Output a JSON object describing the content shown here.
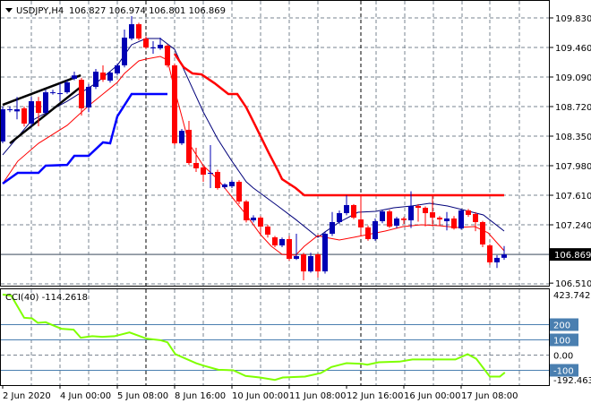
{
  "header": {
    "symbol_timeframe": "USDJPY,H4",
    "ohlc": "106.827 106.974 106.801 106.869"
  },
  "indicator": {
    "label": "CCI(40) -114.2618",
    "max_label": "423.7426",
    "min_label": "-192.4639",
    "levels": [
      {
        "value": 200,
        "label": "200"
      },
      {
        "value": 100,
        "label": "100"
      },
      {
        "value": 0,
        "label": "0.00"
      },
      {
        "value": -100,
        "label": "-100"
      }
    ]
  },
  "colors": {
    "bull": "#0000b4",
    "bear": "#ff0000",
    "grid": "#7a8490",
    "ma_fast": "#00007a",
    "ma_slow": "#ff0000",
    "envelope_red": "#ff0000",
    "envelope_blue": "#0000ff",
    "cci": "#7fff00",
    "level_line": "#4a7fb0",
    "price_tag_bg": "#000000"
  },
  "chart_data": {
    "type": "candlestick",
    "title": "USDJPY,H4",
    "ylim": [
      106.51,
      109.83
    ],
    "price_ticks": [
      "109.830",
      "109.460",
      "109.090",
      "108.720",
      "108.350",
      "107.980",
      "107.610",
      "107.240",
      "106.510"
    ],
    "current_price": "106.869",
    "x_tick_labels": [
      "2 Jun 2020",
      "4 Jun 00:00",
      "5 Jun 08:00",
      "8 Jun 16:00",
      "10 Jun 00:00",
      "11 Jun 08:00",
      "12 Jun 16:00",
      "16 Jun 00:00",
      "17 Jun 08:00"
    ],
    "candles": [
      [
        108.283,
        108.686,
        108.72,
        108.26
      ],
      [
        108.686,
        108.686,
        108.72,
        108.65
      ],
      [
        108.66,
        108.686,
        108.84,
        108.56
      ],
      [
        108.698,
        108.507,
        108.72,
        108.47
      ],
      [
        108.507,
        108.787,
        108.84,
        108.47
      ],
      [
        108.787,
        108.641,
        108.84,
        108.473
      ],
      [
        108.641,
        108.899,
        108.93,
        108.62
      ],
      [
        108.899,
        108.899,
        108.93,
        108.87
      ],
      [
        108.88,
        108.888,
        109.011,
        108.787
      ],
      [
        108.899,
        109.023,
        109.05,
        108.88
      ],
      [
        109.068,
        109.11,
        109.157,
        109.05
      ],
      [
        109.056,
        108.698,
        109.08,
        108.608
      ],
      [
        108.709,
        108.967,
        109.0,
        108.65
      ],
      [
        108.967,
        109.157,
        109.191,
        108.94
      ],
      [
        109.146,
        109.056,
        109.236,
        109.03
      ],
      [
        109.045,
        109.146,
        109.16,
        109.02
      ],
      [
        109.135,
        109.236,
        109.26,
        109.11
      ],
      [
        109.236,
        109.583,
        109.684,
        109.21
      ],
      [
        109.572,
        109.751,
        109.852,
        109.55
      ],
      [
        109.751,
        109.572,
        109.77,
        109.55
      ],
      [
        109.572,
        109.46,
        109.6,
        109.44
      ],
      [
        109.46,
        109.46,
        109.538,
        109.381
      ],
      [
        109.449,
        109.494,
        109.583,
        109.43
      ],
      [
        109.482,
        109.236,
        109.5,
        109.21
      ],
      [
        109.236,
        108.26,
        109.26,
        108.24
      ],
      [
        108.26,
        108.417,
        108.44,
        108.24
      ],
      [
        108.429,
        108.014,
        108.541,
        107.99
      ],
      [
        108.014,
        107.947,
        108.204,
        107.902
      ],
      [
        107.958,
        107.868,
        107.98,
        107.778
      ],
      [
        107.891,
        107.891,
        108.238,
        107.7
      ],
      [
        107.902,
        107.7,
        107.93,
        107.68
      ],
      [
        107.711,
        107.745,
        107.76,
        107.69
      ],
      [
        107.722,
        107.778,
        107.8,
        107.7
      ],
      [
        107.778,
        107.532,
        107.8,
        107.5
      ],
      [
        107.532,
        107.296,
        107.55,
        107.27
      ],
      [
        107.296,
        107.33,
        107.36,
        107.27
      ],
      [
        107.33,
        107.218,
        107.35,
        107.12
      ],
      [
        107.218,
        107.117,
        107.24,
        107.08
      ],
      [
        107.083,
        106.982,
        107.1,
        106.96
      ],
      [
        106.982,
        107.061,
        107.08,
        106.96
      ],
      [
        107.061,
        106.814,
        107.1,
        106.79
      ],
      [
        106.814,
        106.848,
        107.128,
        106.8
      ],
      [
        106.87,
        106.657,
        106.89,
        106.545
      ],
      [
        106.657,
        106.848,
        106.89,
        106.64
      ],
      [
        106.87,
        106.657,
        106.88,
        106.58
      ],
      [
        106.657,
        107.128,
        107.15,
        106.63
      ],
      [
        107.128,
        107.274,
        107.4,
        107.1
      ],
      [
        107.274,
        107.386,
        107.42,
        107.25
      ],
      [
        107.386,
        107.487,
        107.61,
        107.36
      ],
      [
        107.487,
        107.33,
        107.5,
        107.31
      ],
      [
        107.307,
        107.207,
        107.61,
        107.1
      ],
      [
        107.207,
        107.061,
        107.23,
        107.04
      ],
      [
        107.061,
        107.285,
        107.32,
        107.04
      ],
      [
        107.285,
        107.408,
        107.43,
        107.26
      ],
      [
        107.408,
        107.218,
        107.43,
        107.2
      ],
      [
        107.229,
        107.319,
        107.34,
        107.2
      ],
      [
        107.319,
        107.3,
        107.34,
        107.25
      ],
      [
        107.296,
        107.476,
        107.66,
        107.2
      ],
      [
        107.476,
        107.453,
        107.5,
        107.28
      ],
      [
        107.453,
        107.386,
        107.47,
        107.22
      ],
      [
        107.397,
        107.33,
        107.61,
        107.22
      ],
      [
        107.33,
        107.307,
        107.35,
        107.23
      ],
      [
        107.285,
        107.319,
        107.4,
        107.17
      ],
      [
        107.319,
        107.195,
        107.35,
        107.18
      ],
      [
        107.195,
        107.42,
        107.44,
        107.18
      ],
      [
        107.42,
        107.364,
        107.44,
        107.34
      ],
      [
        107.375,
        107.274,
        107.4,
        107.16
      ],
      [
        107.274,
        106.994,
        107.29,
        106.96
      ],
      [
        106.982,
        106.77,
        107.0,
        106.74
      ],
      [
        106.77,
        106.826,
        106.86,
        106.7
      ],
      [
        106.827,
        106.869,
        106.974,
        106.801
      ]
    ],
    "lines": [
      {
        "name": "ma-fast",
        "points": [
          [
            0,
            108.115
          ],
          [
            4,
            108.541
          ],
          [
            9,
            108.787
          ],
          [
            13,
            109.011
          ],
          [
            16,
            109.236
          ],
          [
            18,
            109.494
          ],
          [
            20,
            109.572
          ],
          [
            22,
            109.572
          ],
          [
            24,
            109.437
          ],
          [
            26,
            109.045
          ],
          [
            28,
            108.653
          ],
          [
            30,
            108.317
          ],
          [
            32,
            108.036
          ],
          [
            34,
            107.778
          ],
          [
            35,
            107.7
          ],
          [
            38.4,
            107.476
          ],
          [
            40.9,
            107.307
          ],
          [
            44,
            107.083
          ],
          [
            45,
            107.151
          ],
          [
            47,
            107.274
          ],
          [
            49.6,
            107.397
          ],
          [
            52.1,
            107.408
          ],
          [
            54.6,
            107.453
          ],
          [
            57.1,
            107.476
          ],
          [
            59.6,
            107.509
          ],
          [
            62.1,
            107.476
          ],
          [
            64.6,
            107.42
          ],
          [
            67.1,
            107.364
          ],
          [
            70,
            107.162
          ]
        ]
      },
      {
        "name": "ma-slow",
        "points": [
          [
            0,
            107.756
          ],
          [
            2.1,
            108.036
          ],
          [
            5,
            108.26
          ],
          [
            9,
            108.485
          ],
          [
            12,
            108.731
          ],
          [
            14,
            108.877
          ],
          [
            16,
            109.023
          ],
          [
            17,
            109.135
          ],
          [
            19,
            109.292
          ],
          [
            20,
            109.314
          ],
          [
            22,
            109.348
          ],
          [
            23,
            109.303
          ],
          [
            24,
            108.933
          ],
          [
            25,
            108.597
          ],
          [
            26,
            108.26
          ],
          [
            28,
            107.98
          ],
          [
            30,
            107.812
          ],
          [
            32,
            107.588
          ],
          [
            34,
            107.364
          ],
          [
            36,
            107.117
          ],
          [
            37.5,
            106.971
          ],
          [
            39,
            106.87
          ],
          [
            40.9,
            106.859
          ],
          [
            42.1,
            106.971
          ],
          [
            44,
            107.106
          ],
          [
            45,
            107.083
          ],
          [
            47,
            107.05
          ],
          [
            49,
            107.083
          ],
          [
            50.9,
            107.117
          ],
          [
            53.4,
            107.162
          ],
          [
            55.9,
            107.218
          ],
          [
            58.4,
            107.24
          ],
          [
            60.9,
            107.229
          ],
          [
            63.4,
            107.207
          ],
          [
            65.9,
            107.218
          ],
          [
            67.75,
            107.14
          ],
          [
            70,
            106.915
          ]
        ]
      },
      {
        "name": "envelope-red",
        "points": [
          [
            24,
            109.381
          ],
          [
            25.25,
            109.213
          ],
          [
            26.5,
            109.135
          ],
          [
            27.75,
            109.123
          ],
          [
            29.6,
            109.011
          ],
          [
            31.5,
            108.877
          ],
          [
            32.75,
            108.877
          ],
          [
            34,
            108.709
          ],
          [
            35.25,
            108.485
          ],
          [
            37.1,
            108.148
          ],
          [
            38.4,
            107.924
          ],
          [
            39,
            107.812
          ],
          [
            40.9,
            107.7
          ],
          [
            42.1,
            107.61
          ],
          [
            70,
            107.61
          ]
        ]
      },
      {
        "name": "envelope-blue",
        "points": [
          [
            0,
            107.756
          ],
          [
            2.1,
            107.891
          ],
          [
            5,
            107.891
          ],
          [
            6,
            107.98
          ],
          [
            9,
            107.99
          ],
          [
            10,
            108.103
          ],
          [
            12,
            108.103
          ],
          [
            14,
            108.272
          ],
          [
            15,
            108.26
          ],
          [
            16,
            108.597
          ],
          [
            18,
            108.877
          ],
          [
            20,
            108.877
          ],
          [
            23,
            108.877
          ]
        ]
      },
      {
        "name": "trendline-upper",
        "points": [
          [
            0,
            108.742
          ],
          [
            10.9,
            109.112
          ]
        ]
      },
      {
        "name": "trendline-lower",
        "points": [
          [
            1,
            108.26
          ],
          [
            11.1,
            108.98
          ]
        ]
      }
    ],
    "cci": {
      "name": "CCI(40)",
      "ylim": [
        -192.4639,
        423.7426
      ],
      "points": [
        [
          0,
          398
        ],
        [
          1.2,
          390
        ],
        [
          3,
          245
        ],
        [
          4.1,
          241
        ],
        [
          4.9,
          212
        ],
        [
          6,
          216
        ],
        [
          6.7,
          202
        ],
        [
          8.2,
          173
        ],
        [
          9.9,
          167
        ],
        [
          10.9,
          114
        ],
        [
          12.5,
          124
        ],
        [
          13.9,
          120
        ],
        [
          15.6,
          124
        ],
        [
          17.7,
          149
        ],
        [
          20.1,
          108
        ],
        [
          22,
          98
        ],
        [
          23,
          84
        ],
        [
          24.1,
          6
        ],
        [
          27,
          -53
        ],
        [
          28,
          -69
        ],
        [
          30.1,
          -96
        ],
        [
          32.2,
          -100
        ],
        [
          33.9,
          -137
        ],
        [
          35.9,
          -147
        ],
        [
          38,
          -163
        ],
        [
          39.1,
          -147
        ],
        [
          42.2,
          -141
        ],
        [
          44.4,
          -118
        ],
        [
          45.9,
          -78
        ],
        [
          48,
          -53
        ],
        [
          50.1,
          -57
        ],
        [
          50.9,
          -63
        ],
        [
          52.5,
          -47
        ],
        [
          55.4,
          -43
        ],
        [
          57.2,
          -29
        ],
        [
          63.2,
          -29
        ],
        [
          64.9,
          6
        ],
        [
          66.1,
          -24
        ],
        [
          68,
          -141
        ],
        [
          69.4,
          -141
        ],
        [
          70.1,
          -114.26
        ]
      ]
    }
  }
}
